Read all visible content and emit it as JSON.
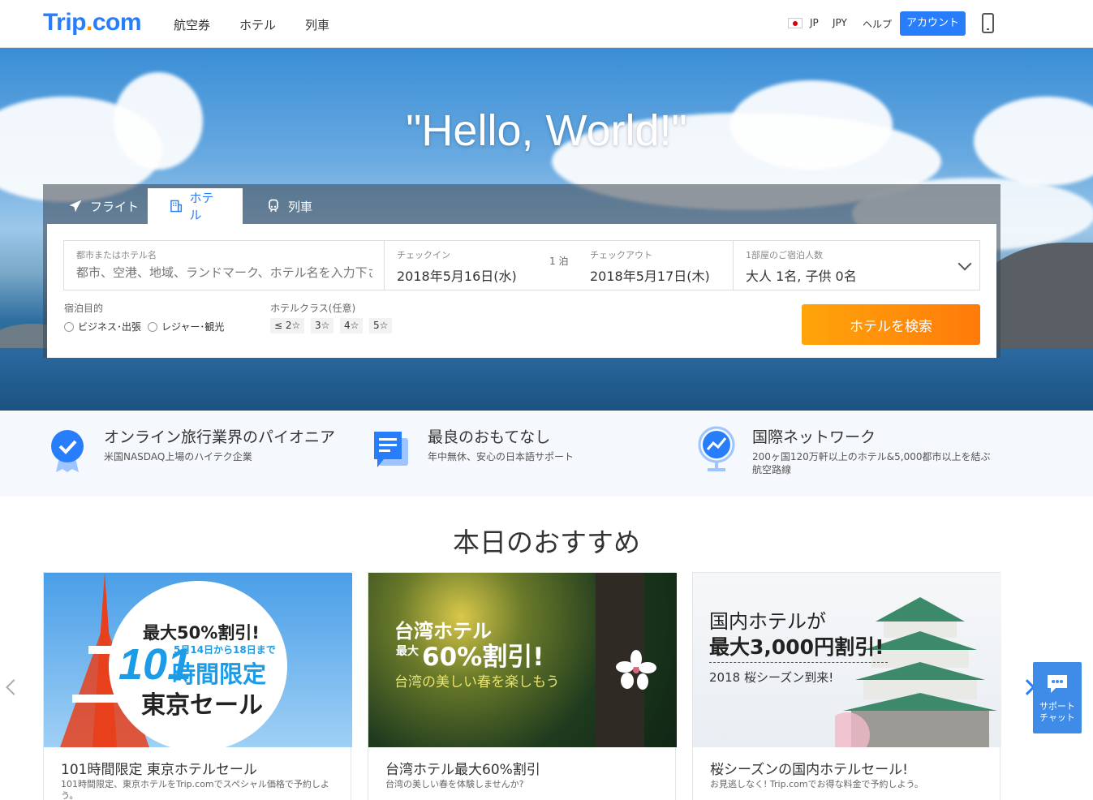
{
  "header": {
    "logo_main": "Trip",
    "logo_dot": ".",
    "logo_tail": "com",
    "nav": [
      "航空券",
      "ホテル",
      "列車"
    ],
    "lang": "JP",
    "currency": "JPY",
    "help": "ヘルプ",
    "account": "アカウント"
  },
  "hero": {
    "title": "\"Hello, World!\""
  },
  "search": {
    "tabs": [
      {
        "label": "フライト",
        "icon": "plane-icon"
      },
      {
        "label": "ホテル",
        "icon": "hotel-icon"
      },
      {
        "label": "列車",
        "icon": "train-icon"
      }
    ],
    "active_tab": 1,
    "city_label": "都市またはホテル名",
    "city_placeholder": "都市、空港、地域、ランドマーク、ホテル名を入力下さい。",
    "checkin_label": "チェックイン",
    "checkin_value": "2018年5月16日(水)",
    "nights": "1 泊",
    "checkout_label": "チェックアウト",
    "checkout_value": "2018年5月17日(木)",
    "guests_label": "1部屋のご宿泊人数",
    "guests_value": "大人 1名, 子供 0名",
    "purpose_label": "宿泊目的",
    "purpose_options": [
      "ビジネス･出張",
      "レジャー･観光"
    ],
    "class_label": "ホテルクラス(任意)",
    "class_options": [
      "≤ 2☆",
      "3☆",
      "4☆",
      "5☆"
    ],
    "search_button": "ホテルを検索"
  },
  "features": [
    {
      "title": "オンライン旅行業界のパイオニア",
      "sub": "米国NASDAQ上場のハイテク企業"
    },
    {
      "title": "最良のおもてなし",
      "sub": "年中無休、安心の日本語サポート"
    },
    {
      "title": "国際ネットワーク",
      "sub": "200ヶ国120万軒以上のホテル&5,000都市以上を結ぶ航空路線"
    }
  ],
  "recommendations": {
    "title": "本日のおすすめ",
    "cards": [
      {
        "title": "101時間限定 東京ホテルセール",
        "desc": "101時間限定、東京ホテルをTrip.comでスペシャル価格で予約しよう。",
        "banner_line1": "最大50%割引!",
        "banner_big": "101",
        "banner_date": "5月14日から18日まで",
        "banner_line2": "時間限定",
        "banner_line3": "東京セール"
      },
      {
        "title": "台湾ホテル最大60%割引",
        "desc": "台湾の美しい春を体験しませんか?",
        "banner_line1": "台湾ホテル",
        "banner_small": "最大",
        "banner_big": "60%割引!",
        "banner_line2": "台湾の美しい春を楽しもう"
      },
      {
        "title": "桜シーズンの国内ホテルセール!",
        "desc": "お見逃しなく! Trip.comでお得な料金で予約しよう。",
        "banner_line1": "国内ホテルが",
        "banner_big": "最大3,000円割引!",
        "banner_line2": "2018 桜シーズン到来!"
      }
    ]
  },
  "chat": {
    "label": "サポートチャット"
  },
  "colors": {
    "primary": "#287dfa",
    "orange": "#ff9100"
  }
}
